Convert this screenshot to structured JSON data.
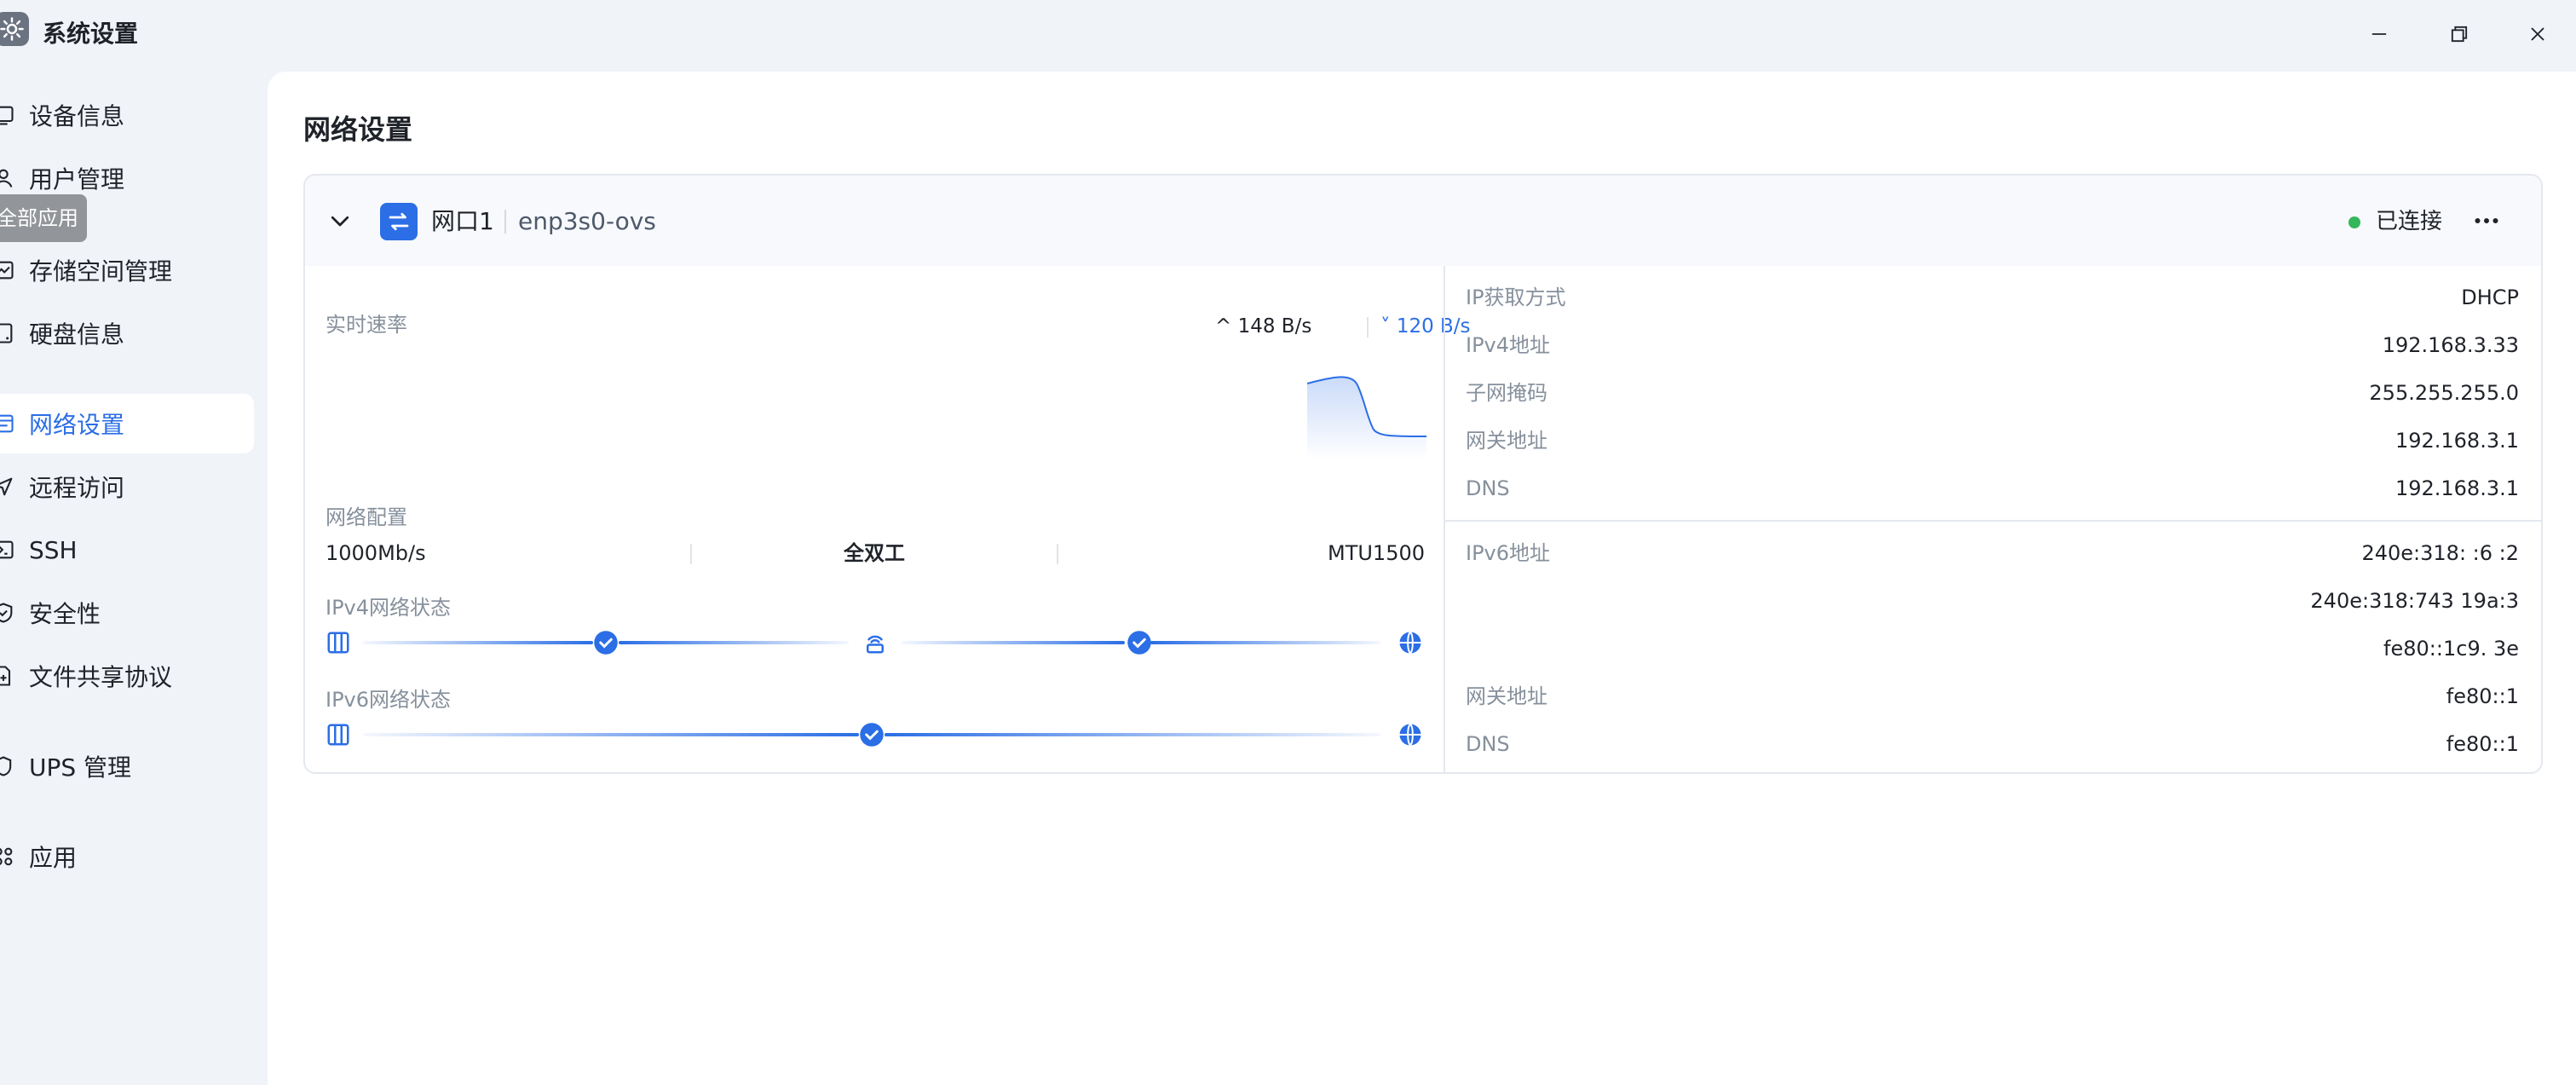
{
  "window": {
    "title": "系统设置"
  },
  "sidebar": {
    "tooltip": "全部应用",
    "items": [
      {
        "label": "设备信息",
        "icon": "device-icon"
      },
      {
        "label": "用户管理",
        "icon": "user-icon"
      },
      {
        "label": "存储空间管理",
        "icon": "storage-icon"
      },
      {
        "label": "硬盘信息",
        "icon": "disk-icon"
      },
      {
        "label": "网络设置",
        "icon": "network-icon",
        "active": true
      },
      {
        "label": "远程访问",
        "icon": "remote-icon"
      },
      {
        "label": "SSH",
        "icon": "terminal-icon"
      },
      {
        "label": "安全性",
        "icon": "shield-icon"
      },
      {
        "label": "文件共享协议",
        "icon": "file-share-icon"
      },
      {
        "label": "UPS 管理",
        "icon": "ups-icon"
      },
      {
        "label": "应用",
        "icon": "apps-icon"
      }
    ]
  },
  "main": {
    "title": "网络设置",
    "port": {
      "name": "网口1",
      "device": "enp3s0-ovs",
      "status": "已连接",
      "status_color": "#34b65a",
      "realtime_label": "实时速率",
      "upload": "148 B/s",
      "download": "120 B/s",
      "config_label": "网络配置",
      "speed": "1000Mb/s",
      "duplex": "全双工",
      "mtu": "MTU1500",
      "ipv4_status_label": "IPv4网络状态",
      "ipv6_status_label": "IPv6网络状态"
    },
    "ipv4": [
      {
        "label": "IP获取方式",
        "value": "DHCP"
      },
      {
        "label": "IPv4地址",
        "value": "192.168.3.33"
      },
      {
        "label": "子网掩码",
        "value": "255.255.255.0"
      },
      {
        "label": "网关地址",
        "value": "192.168.3.1"
      },
      {
        "label": "DNS",
        "value": "192.168.3.1"
      }
    ],
    "ipv6": {
      "address_label": "IPv6地址",
      "addresses": [
        "240e:318:    :6  :2",
        "240e:318:743    19a:3",
        "fe80::1c9.     3e"
      ],
      "gateway_label": "网关地址",
      "gateway": "fe80::1",
      "dns_label": "DNS",
      "dns": "fe80::1"
    }
  },
  "colors": {
    "accent": "#2b6ee6",
    "background": "#f0f3f8"
  }
}
